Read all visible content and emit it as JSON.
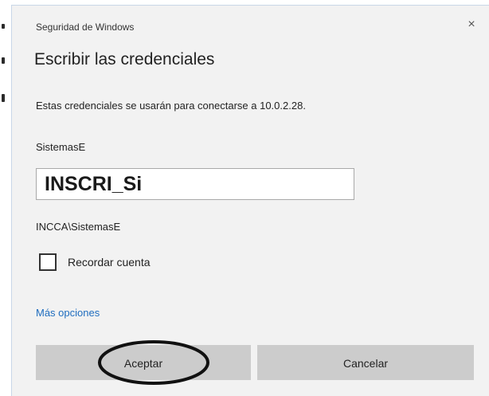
{
  "dialog": {
    "window_title": "Seguridad de Windows",
    "close_glyph": "×",
    "heading": "Escribir las credenciales",
    "description": "Estas credenciales se usarán para conectarse a 10.0.2.28.",
    "username": "SistemasE",
    "password_value": "INSCRI_Si",
    "domain_user": "INCCA\\SistemasE",
    "remember_label": "Recordar cuenta",
    "remember_checked": false,
    "more_options": "Más opciones",
    "ok_label": "Aceptar",
    "cancel_label": "Cancelar"
  },
  "colors": {
    "dialog_bg": "#f2f2f2",
    "button_bg": "#cccccc",
    "link": "#1f6dbf",
    "annotation": "#111111"
  }
}
